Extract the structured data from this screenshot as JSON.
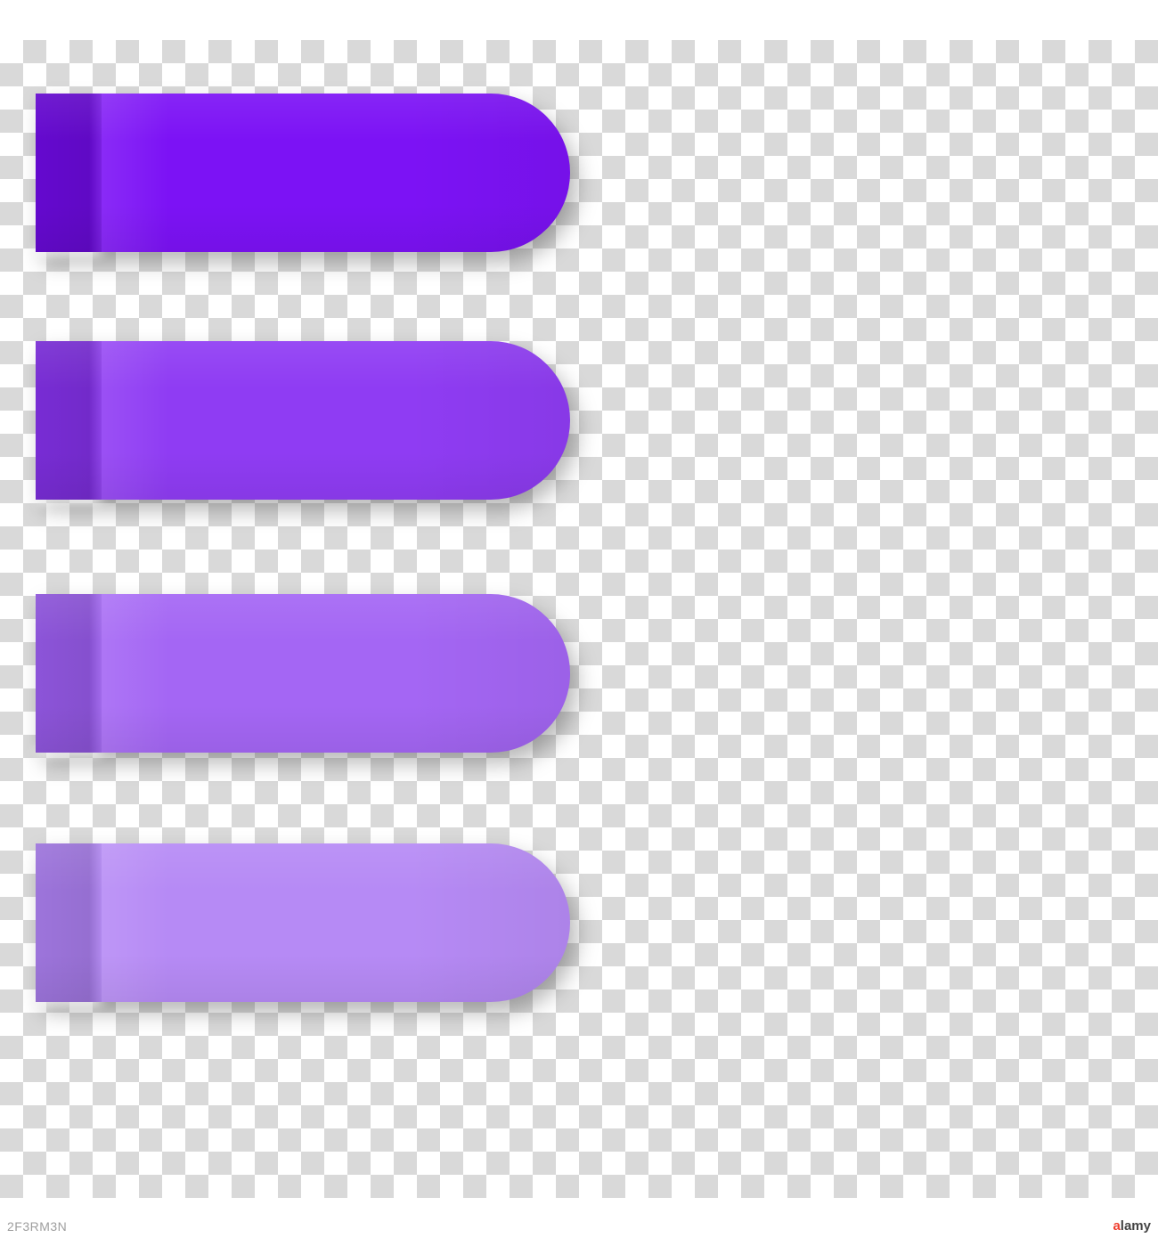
{
  "stickers": [
    {
      "color": "#7c12f5",
      "fold": "#6d0ae0"
    },
    {
      "color": "#8f3cf3",
      "fold": "#8230e6"
    },
    {
      "color": "#a466f4",
      "fold": "#985beb"
    },
    {
      "color": "#b68af5",
      "fold": "#aa7eee"
    }
  ],
  "watermark_id": "2F3RM3N",
  "logo_text_prefix": "a",
  "logo_text_rest": "lamy"
}
